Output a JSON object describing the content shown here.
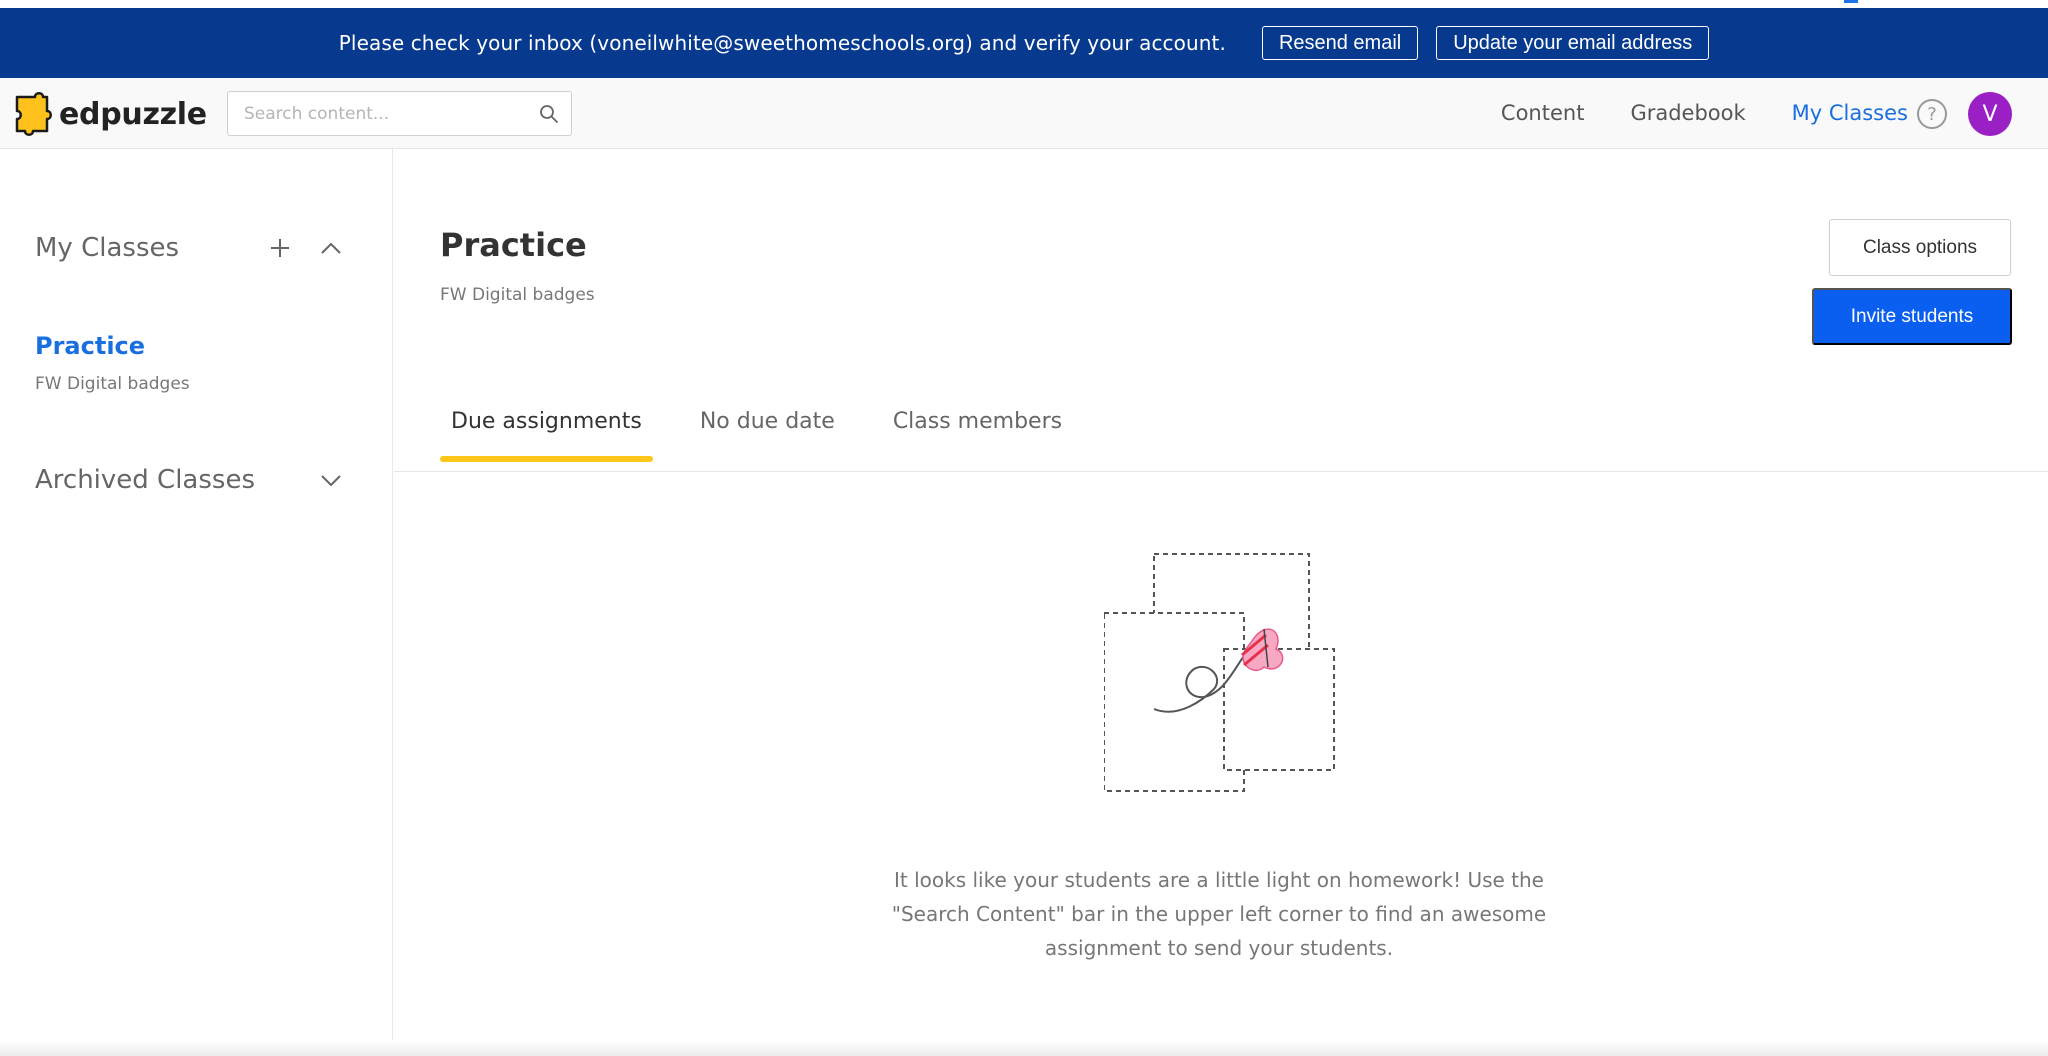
{
  "banner": {
    "message": "Please check your inbox (voneilwhite@sweethomeschools.org) and verify your account.",
    "resend_label": "Resend email",
    "update_label": "Update your email address"
  },
  "header": {
    "logo_text": "edpuzzle",
    "search_placeholder": "Search content...",
    "nav": {
      "content": "Content",
      "gradebook": "Gradebook",
      "my_classes": "My Classes"
    },
    "help_glyph": "?",
    "avatar_initial": "V"
  },
  "sidebar": {
    "my_classes_heading": "My Classes",
    "class_name": "Practice",
    "class_subtitle": "FW Digital badges",
    "archived_heading": "Archived Classes"
  },
  "main": {
    "title": "Practice",
    "subtitle": "FW Digital badges",
    "class_options_label": "Class options",
    "invite_label": "Invite students",
    "tabs": [
      {
        "label": "Due assignments",
        "active": true
      },
      {
        "label": "No due date",
        "active": false
      },
      {
        "label": "Class members",
        "active": false
      }
    ],
    "empty_message": "It looks like your students are a little light on homework! Use the \"Search Content\" bar in the upper left corner to find an awesome assignment to send your students."
  },
  "colors": {
    "banner_bg": "#073a8e",
    "accent_blue": "#0a5ff0",
    "tab_underline": "#ffc61a",
    "avatar_purple": "#9a1fc4"
  },
  "icons": [
    "edpuzzle-logo-icon",
    "search-icon",
    "plus-icon",
    "chevron-up-icon",
    "chevron-down-icon",
    "help-icon",
    "empty-state-illustration"
  ]
}
